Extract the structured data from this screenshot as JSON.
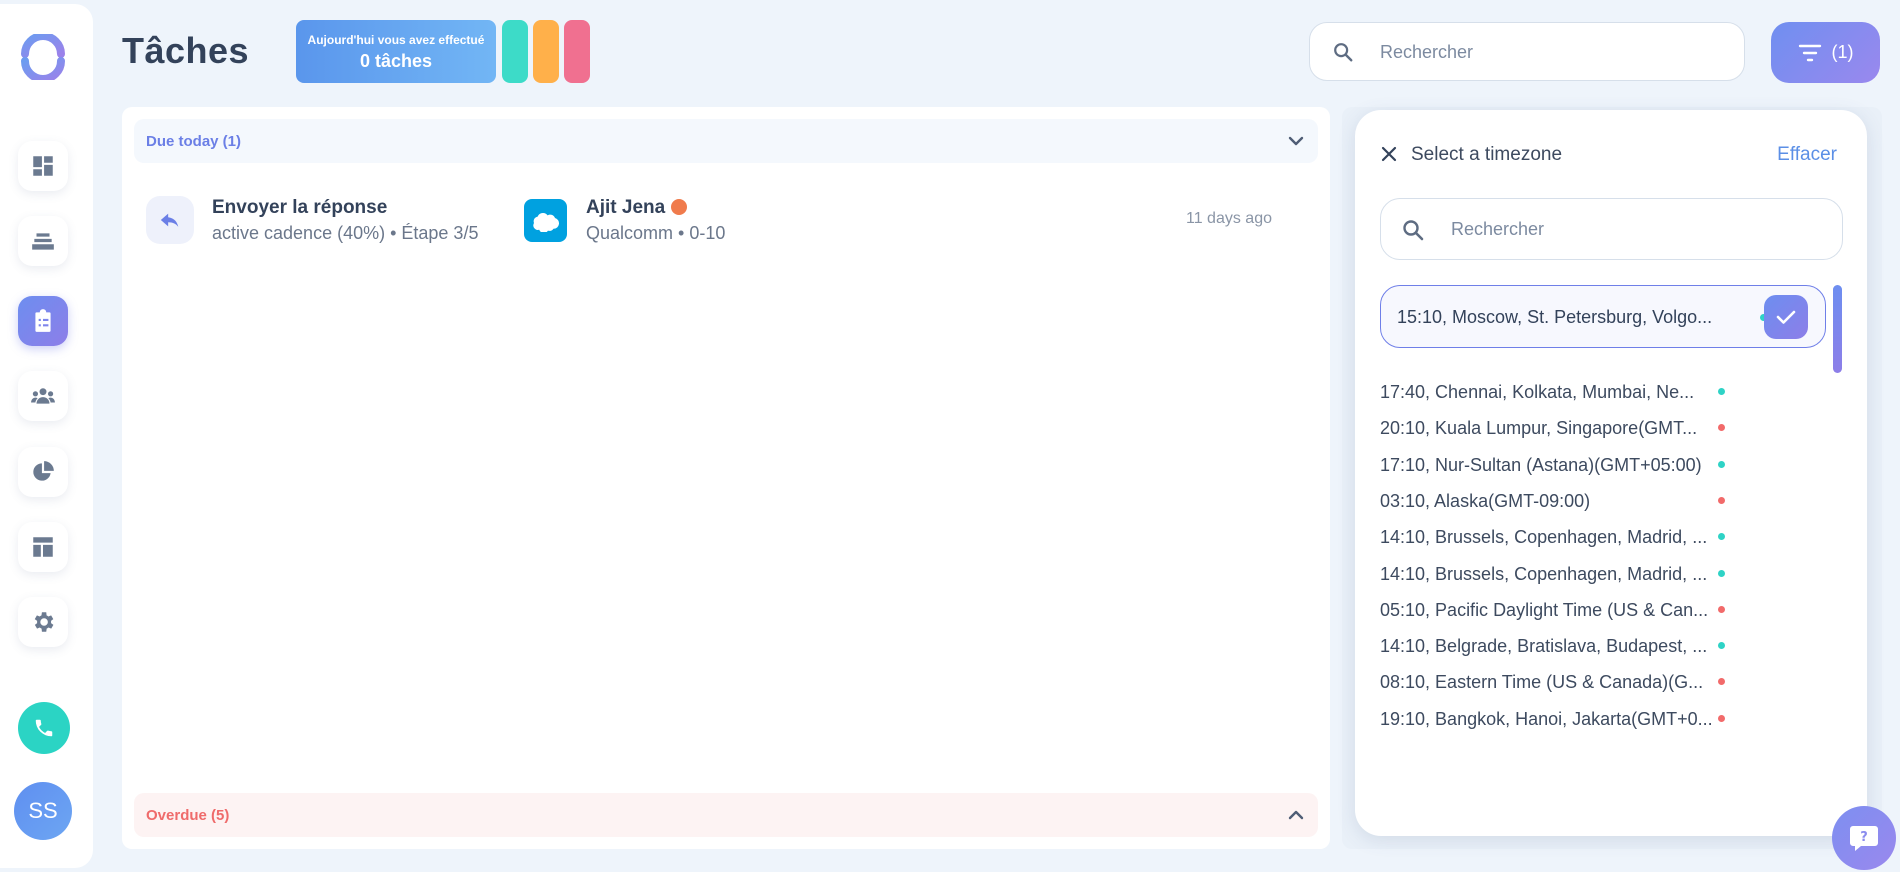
{
  "header": {
    "title": "Tâches",
    "today_line1": "Aujourd'hui vous avez effectué",
    "today_line2": "0 tâches",
    "bar_colors": [
      "#3ddbc8",
      "#ffb04a",
      "#f07090"
    ],
    "search_placeholder": "Rechercher",
    "filter_label": "(1)"
  },
  "sidebar": {
    "items": [
      "dashboard-icon",
      "layers-icon",
      "tasks-icon",
      "team-icon",
      "pie-chart-icon",
      "layout-icon",
      "settings-icon"
    ],
    "active": "tasks-icon",
    "avatar_initials": "SS"
  },
  "tasks": {
    "due_header": "Due today (1)",
    "overdue_header": "Overdue (5)",
    "items": [
      {
        "title": "Envoyer la réponse",
        "subtitle": "active cadence (40%) • Étape 3/5",
        "contact_name": "Ajit Jena",
        "contact_sub": "Qualcomm • 0-10",
        "time_ago": "11 days ago"
      }
    ]
  },
  "timezone_panel": {
    "title": "Select a timezone",
    "clear_label": "Effacer",
    "search_placeholder": "Rechercher",
    "selected": {
      "label": "15:10, Moscow, St. Petersburg, Volgo...",
      "status": "green"
    },
    "items": [
      {
        "label": "17:40, Chennai, Kolkata, Mumbai, Ne...",
        "status": "green"
      },
      {
        "label": "20:10, Kuala Lumpur, Singapore(GMT...",
        "status": "red"
      },
      {
        "label": "17:10, Nur-Sultan (Astana)(GMT+05:00)",
        "status": "green"
      },
      {
        "label": "03:10, Alaska(GMT-09:00)",
        "status": "red"
      },
      {
        "label": "14:10, Brussels, Copenhagen, Madrid, ...",
        "status": "green"
      },
      {
        "label": "14:10, Brussels, Copenhagen, Madrid, ...",
        "status": "green"
      },
      {
        "label": "05:10, Pacific Daylight Time (US & Can...",
        "status": "red"
      },
      {
        "label": "14:10, Belgrade, Bratislava, Budapest, ...",
        "status": "green"
      },
      {
        "label": "08:10, Eastern Time (US & Canada)(G...",
        "status": "red"
      },
      {
        "label": "19:10, Bangkok, Hanoi, Jakarta(GMT+0...",
        "status": "red"
      }
    ]
  },
  "colors": {
    "green": "#2ed3c6",
    "red": "#f26a6a",
    "accent": "#6d8ef0"
  }
}
